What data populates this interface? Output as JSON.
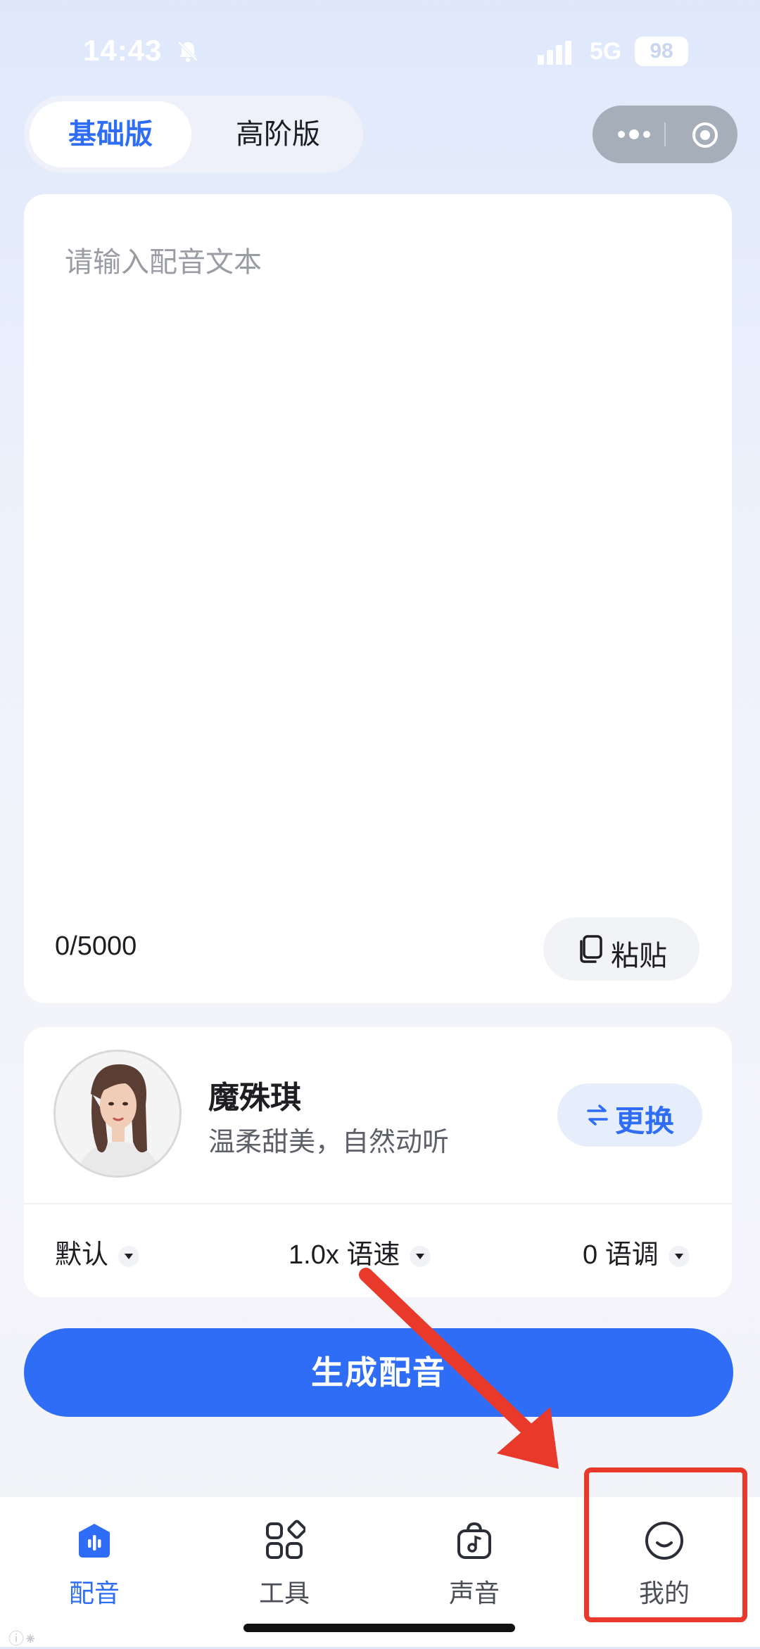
{
  "status_bar": {
    "time": "14:43",
    "network": "5G",
    "battery": "98"
  },
  "tabs": [
    {
      "label": "基础版",
      "active": true
    },
    {
      "label": "高阶版",
      "active": false
    }
  ],
  "editor": {
    "placeholder": "请输入配音文本",
    "char_count": "0/5000",
    "paste_label": "粘贴"
  },
  "voice": {
    "name": "魔殊琪",
    "description": "温柔甜美，自然动听",
    "change_label": "更换",
    "options": [
      {
        "label": "默认"
      },
      {
        "label": "1.0x 语速"
      },
      {
        "label": "0 语调"
      }
    ]
  },
  "generate_label": "生成配音",
  "bottom_nav": [
    {
      "label": "配音",
      "icon": "audio-wave-icon",
      "active": true
    },
    {
      "label": "工具",
      "icon": "grid-tools-icon",
      "active": false
    },
    {
      "label": "声音",
      "icon": "music-bag-icon",
      "active": false
    },
    {
      "label": "我的",
      "icon": "smile-face-icon",
      "active": false
    }
  ],
  "colors": {
    "accent": "#2f6df6",
    "annotation": "#e8392b"
  }
}
